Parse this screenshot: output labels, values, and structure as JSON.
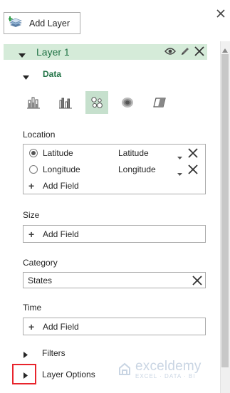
{
  "toolbar": {
    "add_layer_label": "Add Layer"
  },
  "layer": {
    "name": "Layer 1"
  },
  "data_section": {
    "title": "Data"
  },
  "viz_types": [
    {
      "name": "stacked-column",
      "selected": false
    },
    {
      "name": "clustered-column",
      "selected": false
    },
    {
      "name": "bubble",
      "selected": true
    },
    {
      "name": "heat-map",
      "selected": false
    },
    {
      "name": "region",
      "selected": false
    }
  ],
  "location": {
    "label": "Location",
    "fields": [
      {
        "name": "Latitude",
        "type": "Latitude",
        "selected": true
      },
      {
        "name": "Longitude",
        "type": "Longitude",
        "selected": false
      }
    ],
    "add_field_label": "Add Field"
  },
  "size": {
    "label": "Size",
    "add_field_label": "Add Field"
  },
  "category": {
    "label": "Category",
    "value": "States"
  },
  "time": {
    "label": "Time",
    "add_field_label": "Add Field"
  },
  "filters": {
    "label": "Filters"
  },
  "layer_options": {
    "label": "Layer Options"
  },
  "watermark": {
    "name": "exceldemy",
    "tagline": "EXCEL · DATA · BI"
  },
  "colors": {
    "accent": "#217346",
    "header_bg": "#d5ebd9",
    "selected_bg": "#c6e0cd",
    "highlight": "#e8242c"
  }
}
